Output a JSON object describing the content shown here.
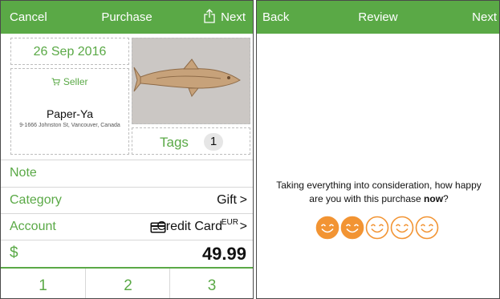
{
  "purchase_screen": {
    "nav": {
      "left": "Cancel",
      "title": "Purchase",
      "right": "Next"
    },
    "date": "26 Sep 2016",
    "seller": {
      "label": "Seller",
      "name": "Paper-Ya",
      "address": "9-1666 Johnston St, Vancouver, Canada"
    },
    "tags": {
      "label": "Tags",
      "count": "1"
    },
    "rows": {
      "note": {
        "label": "Note"
      },
      "category": {
        "label": "Category",
        "value": "Gift",
        "chevron": ">"
      },
      "account": {
        "label": "Account",
        "value": "Credit Card",
        "currency": "EUR",
        "chevron": ">"
      },
      "amount": {
        "label": "$",
        "value": "49.99"
      }
    },
    "keypad": [
      "1",
      "2",
      "3"
    ]
  },
  "review_screen": {
    "nav": {
      "left": "Back",
      "title": "Review",
      "right": "Next"
    },
    "question_prefix": "Taking everything into consideration, how happy are you with this purchase ",
    "question_emphasis": "now",
    "question_suffix": "?",
    "rating": {
      "selected": 2,
      "max": 5
    }
  },
  "colors": {
    "accent": "#5aa946",
    "rating_fill": "#f29433"
  },
  "icons": [
    "share-icon",
    "cart-icon",
    "credit-card-icon",
    "smiley-icon"
  ]
}
